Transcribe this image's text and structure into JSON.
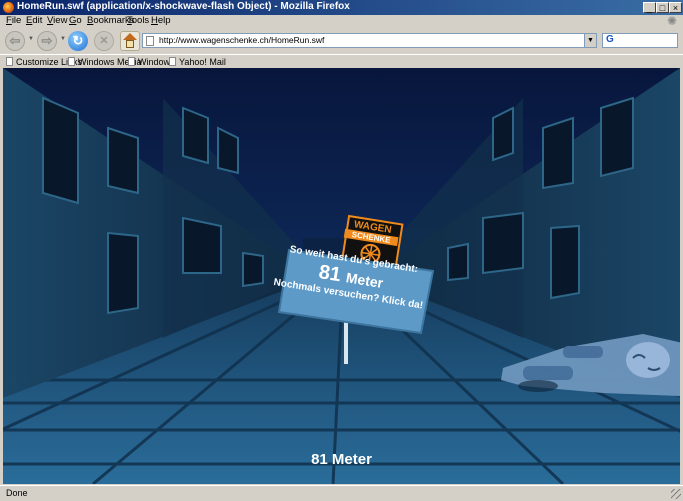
{
  "window": {
    "title": "HomeRun.swf (application/x-shockwave-flash Object) - Mozilla Firefox",
    "buttons": {
      "minimize": "_",
      "maximize": "□",
      "close": "×"
    }
  },
  "menu": {
    "items": [
      "File",
      "Edit",
      "View",
      "Go",
      "Bookmarks",
      "Tools",
      "Help"
    ]
  },
  "navigation": {
    "url": "http://www.wagenschenke.ch/HomeRun.swf",
    "back_glyph": "⇦",
    "forward_glyph": "⇨",
    "reload_glyph": "↻",
    "stop_glyph": "✕",
    "search_engine_glyph": "G"
  },
  "bookmarks": {
    "items": [
      "Customize Links",
      "Windows Media",
      "Windows",
      "Yahoo! Mail"
    ]
  },
  "game": {
    "logo_line1": "WAGEN",
    "logo_line2": "SCHENKE",
    "sign_line1": "So weit hast du's gebracht:",
    "sign_distance": "81",
    "sign_unit": "Meter",
    "sign_line3": "Nochmals versuchen? Klick da!",
    "score_text": "81 Meter"
  },
  "status": {
    "text": "Done"
  },
  "colors": {
    "titlebar_start": "#0a246a",
    "titlebar_end": "#3a6ea5",
    "chrome": "#d4d0c8",
    "sky": "#0a1a44",
    "street": "#1f5680",
    "sign": "#5e9ac8",
    "logo_orange": "#f08a1c"
  }
}
